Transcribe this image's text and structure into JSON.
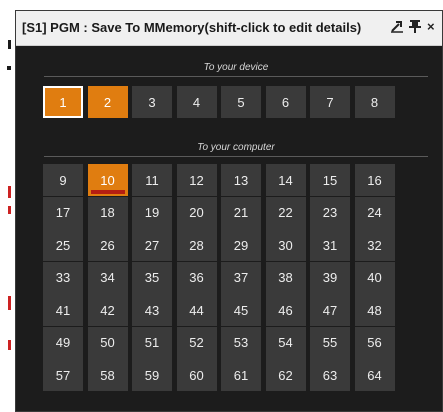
{
  "window": {
    "title": "[S1] PGM : Save To MMemory(shift-click to edit details)",
    "icons": [
      "popout-icon",
      "pin-icon",
      "close-icon"
    ]
  },
  "device_section": {
    "label": "To your device",
    "slots": [
      "1",
      "2",
      "3",
      "4",
      "5",
      "6",
      "7",
      "8"
    ],
    "selected": [
      "1",
      "2"
    ],
    "outlined": "1"
  },
  "computer_section": {
    "label": "To your computer",
    "slots": [
      "9",
      "10",
      "11",
      "12",
      "13",
      "14",
      "15",
      "16",
      "17",
      "18",
      "19",
      "20",
      "21",
      "22",
      "23",
      "24",
      "25",
      "26",
      "27",
      "28",
      "29",
      "30",
      "31",
      "32",
      "33",
      "34",
      "35",
      "36",
      "37",
      "38",
      "39",
      "40",
      "41",
      "42",
      "43",
      "44",
      "45",
      "46",
      "47",
      "48",
      "49",
      "50",
      "51",
      "52",
      "53",
      "54",
      "55",
      "56",
      "57",
      "58",
      "59",
      "60",
      "61",
      "62",
      "63",
      "64"
    ],
    "selected": "10"
  },
  "colors": {
    "panel_bg": "#1c1c1c",
    "tile_bg": "#3a3a3a",
    "selected_bg": "#e07d10",
    "underline": "#b51e12"
  }
}
